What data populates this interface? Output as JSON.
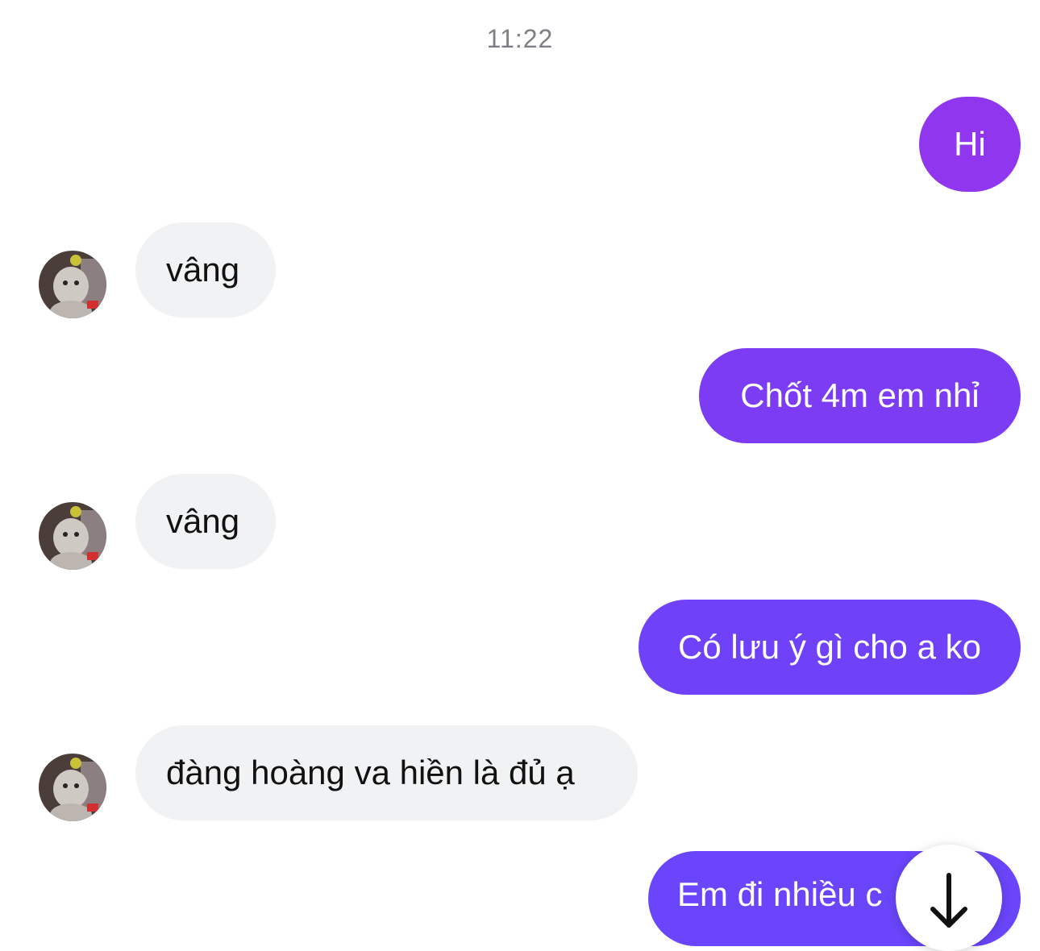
{
  "chat": {
    "timestamp": "11:22",
    "messages": [
      {
        "direction": "outgoing",
        "text": "Hi"
      },
      {
        "direction": "incoming",
        "text": "vâng"
      },
      {
        "direction": "outgoing",
        "text": "Chốt 4m em nhỉ"
      },
      {
        "direction": "incoming",
        "text": "vâng"
      },
      {
        "direction": "outgoing",
        "text": "Có lưu ý gì cho a ko"
      },
      {
        "direction": "incoming",
        "text": "đàng hoàng va hiền là đủ ạ"
      },
      {
        "direction": "outgoing",
        "text": "Em đi nhiều c"
      }
    ]
  },
  "icons": {
    "avatar": "contact-avatar",
    "scroll_down": "arrow-down-icon"
  },
  "colors": {
    "outgoing_gradient_top": "#9b32ea",
    "outgoing_gradient_bottom": "#6a45fb",
    "incoming_bubble": "#f1f2f4",
    "timestamp_text": "#7d8086"
  }
}
